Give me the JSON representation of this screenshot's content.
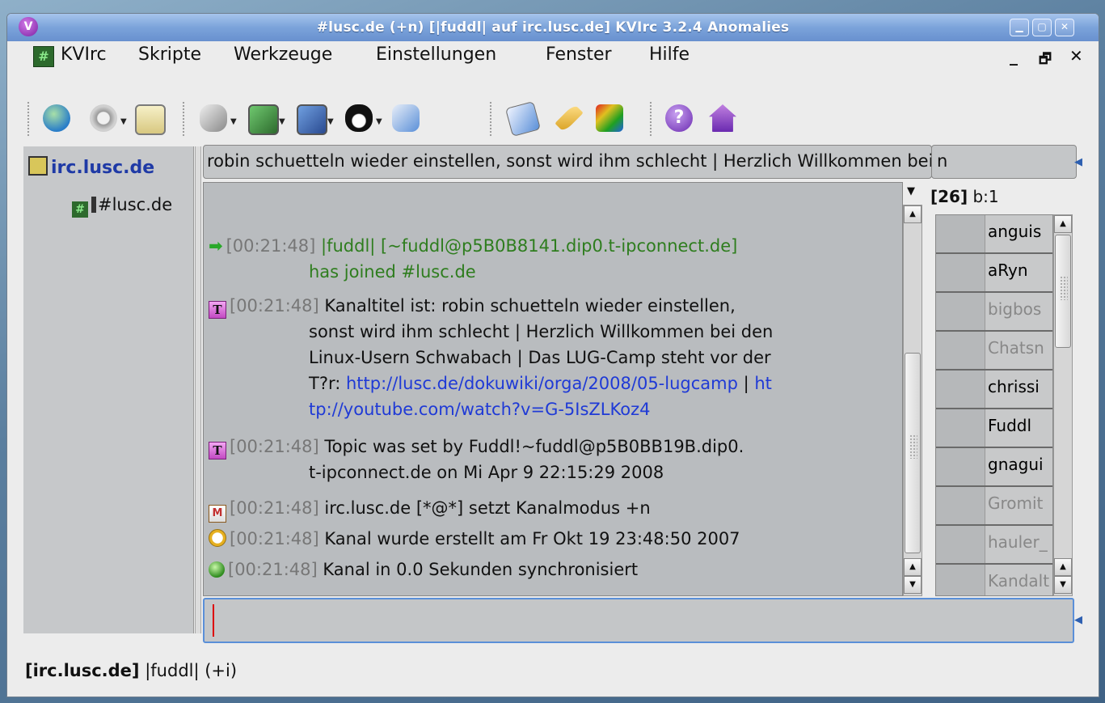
{
  "window": {
    "title": "#lusc.de (+n) [|fuddl| auf irc.lusc.de] KVIrc 3.2.4 Anomalies",
    "app_icon_letter": "V"
  },
  "menubar": {
    "items": [
      "KVIrc",
      "Skripte",
      "Werkzeuge",
      "Einstellungen",
      "Fenster",
      "Hilfe"
    ]
  },
  "toolbar": {
    "icons": [
      "connect-globe",
      "options-gear",
      "window-list",
      "masks",
      "image-settings",
      "editor",
      "tux-penguin",
      "script-disk",
      "notes",
      "wrench",
      "color-paint",
      "help-question",
      "home"
    ]
  },
  "tree": {
    "server": "irc.lusc.de",
    "channel": "#lusc.de"
  },
  "channel": {
    "topic": "robin schuetteln wieder einstellen, sonst wird ihm schlecht | Herzlich Willkommen bei den Linux-Usern Schwabach",
    "mode": "n",
    "user_count": "[26]",
    "ban_count": "b:1"
  },
  "messages": [
    {
      "icon": "join-arrow-icon",
      "time": "[00:21:48]",
      "line1": "|fuddl| [~fuddl@p5B0B8141.dip0.t-ipconnect.de]",
      "line2": "has joined #lusc.de"
    },
    {
      "icon": "topic-icon",
      "time": "[00:21:48]",
      "line1": "Kanaltitel ist: robin schuetteln wieder einstellen,",
      "line2": "sonst wird ihm schlecht | Herzlich Willkommen bei den",
      "line3": "Linux-Usern Schwabach | Das LUG-Camp steht vor der",
      "line4_pre": "T?r: ",
      "link1": "http://lusc.de/dokuwiki/orga/2008/05-lugcamp",
      "line4_sep": " | ",
      "link2a": "ht",
      "link2b": "tp://youtube.com/watch?v=G-5IsZLKoz4"
    },
    {
      "icon": "topic-icon",
      "time": "[00:21:48]",
      "line1": "Topic was set by Fuddl!~fuddl@p5B0BB19B.dip0.",
      "line2": "t-ipconnect.de on Mi Apr 9 22:15:29 2008"
    },
    {
      "icon": "mode-icon",
      "time": "[00:21:48]",
      "line1": "irc.lusc.de [*@*] setzt Kanalmodus +n"
    },
    {
      "icon": "clock-icon",
      "time": "[00:21:48]",
      "line1": "Kanal wurde erstellt am Fr Okt 19 23:48:50 2007"
    },
    {
      "icon": "sync-icon",
      "time": "[00:21:48]",
      "line1": "Kanal in 0.0 Sekunden synchronisiert"
    }
  ],
  "users": [
    {
      "nick": "anguis",
      "away": false
    },
    {
      "nick": "aRyn",
      "away": false
    },
    {
      "nick": "bigbos",
      "away": true
    },
    {
      "nick": "Chatsn",
      "away": true
    },
    {
      "nick": "chrissi",
      "away": false
    },
    {
      "nick": "Fuddl",
      "away": false
    },
    {
      "nick": "gnagui",
      "away": false
    },
    {
      "nick": "Gromit",
      "away": true
    },
    {
      "nick": "hauler_",
      "away": true
    },
    {
      "nick": "Kandalt",
      "away": true
    }
  ],
  "input": {
    "value": ""
  },
  "status": {
    "server": "[irc.lusc.de]",
    "nick": "|fuddl| (+i)"
  },
  "colors": {
    "join": "#2e7d1e",
    "link": "#1f3ad6",
    "timestamp": "#777777",
    "away": "#888888"
  }
}
